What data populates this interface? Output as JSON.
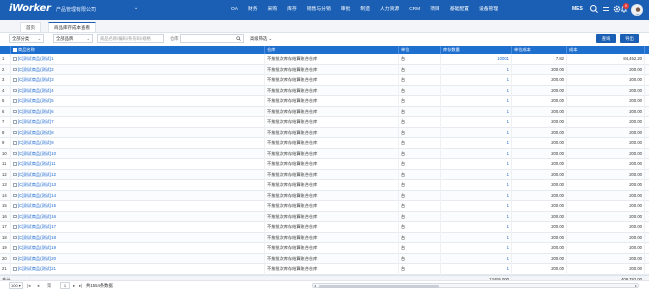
{
  "app": {
    "logo": "iWorker",
    "company": "产品管理有限公司",
    "menu": [
      "OA",
      "财务",
      "采购",
      "库存",
      "销售与分销",
      "审批",
      "制造",
      "人力资源",
      "CRM",
      "项目",
      "基础配置",
      "设备管理"
    ],
    "mes_label": "MES",
    "notification_count": "9"
  },
  "tabs": {
    "home": "首页",
    "active": "商品库存成本查看"
  },
  "filters": {
    "category": "全部分类",
    "brand": "全部品牌",
    "search_placeholder": "商品名称/编码/条形码/规格",
    "warehouse_label": "仓库",
    "advanced": "高级筛选",
    "query_button": "查询",
    "export_button": "导出"
  },
  "table": {
    "columns": [
      "商品名称",
      "仓库",
      "单位",
      "库存数量",
      "单位成本",
      "成本"
    ],
    "rows": [
      {
        "no": "1",
        "name": "[C]测试商品(测试)1",
        "warehouse": "不按批次库存结算账合仓库",
        "unit": "台",
        "qty": "10001",
        "unit_cost": "7.82",
        "cost": "84,452.20"
      },
      {
        "no": "2",
        "name": "[C]测试商品(测试)2",
        "warehouse": "不按批次库存结算账合仓库",
        "unit": "台",
        "qty": "1",
        "unit_cost": "200.00",
        "cost": "200.00"
      },
      {
        "no": "3",
        "name": "[C]测试商品(测试)3",
        "warehouse": "不按批次库存结算账合仓库",
        "unit": "台",
        "qty": "1",
        "unit_cost": "200.00",
        "cost": "200.00"
      },
      {
        "no": "4",
        "name": "[C]测试商品(测试)4",
        "warehouse": "不按批次库存结算账合仓库",
        "unit": "台",
        "qty": "1",
        "unit_cost": "200.00",
        "cost": "200.00"
      },
      {
        "no": "5",
        "name": "[C]测试商品(测试)5",
        "warehouse": "不按批次库存结算账合仓库",
        "unit": "台",
        "qty": "1",
        "unit_cost": "200.00",
        "cost": "200.00"
      },
      {
        "no": "6",
        "name": "[C]测试商品(测试)6",
        "warehouse": "不按批次库存结算账合仓库",
        "unit": "台",
        "qty": "1",
        "unit_cost": "200.00",
        "cost": "200.00"
      },
      {
        "no": "7",
        "name": "[C]测试商品(测试)7",
        "warehouse": "不按批次库存结算账合仓库",
        "unit": "台",
        "qty": "1",
        "unit_cost": "200.00",
        "cost": "200.00"
      },
      {
        "no": "8",
        "name": "[C]测试商品(测试)8",
        "warehouse": "不按批次库存结算账合仓库",
        "unit": "台",
        "qty": "1",
        "unit_cost": "200.00",
        "cost": "200.00"
      },
      {
        "no": "9",
        "name": "[C]测试商品(测试)9",
        "warehouse": "不按批次库存结算账合仓库",
        "unit": "台",
        "qty": "1",
        "unit_cost": "200.00",
        "cost": "200.00"
      },
      {
        "no": "10",
        "name": "[C]测试商品(测试)10",
        "warehouse": "不按批次库存结算账合仓库",
        "unit": "台",
        "qty": "1",
        "unit_cost": "200.00",
        "cost": "200.00"
      },
      {
        "no": "11",
        "name": "[C]测试商品(测试)11",
        "warehouse": "不按批次库存结算账合仓库",
        "unit": "台",
        "qty": "1",
        "unit_cost": "200.00",
        "cost": "200.00"
      },
      {
        "no": "12",
        "name": "[C]测试商品(测试)12",
        "warehouse": "不按批次库存结算账合仓库",
        "unit": "台",
        "qty": "1",
        "unit_cost": "200.00",
        "cost": "200.00"
      },
      {
        "no": "13",
        "name": "[C]测试商品(测试)13",
        "warehouse": "不按批次库存结算账合仓库",
        "unit": "台",
        "qty": "1",
        "unit_cost": "200.00",
        "cost": "200.00"
      },
      {
        "no": "14",
        "name": "[C]测试商品(测试)14",
        "warehouse": "不按批次库存结算账合仓库",
        "unit": "台",
        "qty": "1",
        "unit_cost": "200.00",
        "cost": "200.00"
      },
      {
        "no": "15",
        "name": "[C]测试商品(测试)15",
        "warehouse": "不按批次库存结算账合仓库",
        "unit": "台",
        "qty": "1",
        "unit_cost": "200.00",
        "cost": "200.00"
      },
      {
        "no": "16",
        "name": "[C]测试商品(测试)16",
        "warehouse": "不按批次库存结算账合仓库",
        "unit": "台",
        "qty": "1",
        "unit_cost": "200.00",
        "cost": "200.00"
      },
      {
        "no": "17",
        "name": "[C]测试商品(测试)17",
        "warehouse": "不按批次库存结算账合仓库",
        "unit": "台",
        "qty": "1",
        "unit_cost": "200.00",
        "cost": "200.00"
      },
      {
        "no": "18",
        "name": "[C]测试商品(测试)18",
        "warehouse": "不按批次库存结算账合仓库",
        "unit": "台",
        "qty": "1",
        "unit_cost": "200.00",
        "cost": "200.00"
      },
      {
        "no": "19",
        "name": "[C]测试商品(测试)19",
        "warehouse": "不按批次库存结算账合仓库",
        "unit": "台",
        "qty": "1",
        "unit_cost": "200.00",
        "cost": "200.00"
      },
      {
        "no": "20",
        "name": "[C]测试商品(测试)20",
        "warehouse": "不按批次库存结算账合仓库",
        "unit": "台",
        "qty": "1",
        "unit_cost": "200.00",
        "cost": "200.00"
      },
      {
        "no": "21",
        "name": "[C]测试商品(测试)21",
        "warehouse": "不按批次库存结算账合仓库",
        "unit": "台",
        "qty": "1",
        "unit_cost": "200.00",
        "cost": "200.00"
      }
    ],
    "total_label": "合计",
    "total_qty": "13455.000",
    "total_cost": "409,782.00"
  },
  "pager": {
    "page_size": "100",
    "current_page": "1",
    "total_text": "共1554条数据"
  },
  "colors": {
    "topbar": "#1a5fb4",
    "header": "#1f6fcf",
    "link": "#1a66d0",
    "badge": "#e23c3c"
  }
}
